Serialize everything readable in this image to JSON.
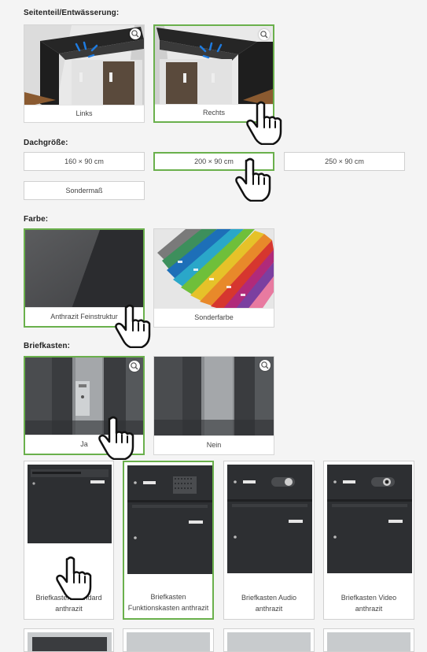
{
  "sections": {
    "seitenteil": {
      "title": "Seitenteil/Entwässerung:",
      "options": [
        "Links",
        "Rechts"
      ]
    },
    "dachgroesse": {
      "title": "Dachgröße:",
      "options": [
        "160 × 90 cm",
        "200 × 90 cm",
        "250 × 90 cm",
        "Sondermaß"
      ]
    },
    "farbe": {
      "title": "Farbe:",
      "options": [
        "Anthrazit Feinstruktur",
        "Sonderfarbe"
      ]
    },
    "briefkasten": {
      "title": "Briefkasten:",
      "options": [
        "Ja",
        "Nein"
      ]
    },
    "mailboxes": [
      {
        "label": "Briefkasten Standard anthrazit"
      },
      {
        "label": "Briefkasten Funktionskasten anthrazit"
      },
      {
        "label": "Briefkasten Audio anthrazit"
      },
      {
        "label": "Briefkasten Video anthrazit"
      }
    ]
  },
  "selected": {
    "seitenteil": "Rechts",
    "dachgroesse": "200 × 90 cm",
    "farbe": "Anthrazit Feinstruktur",
    "briefkasten": "Ja",
    "mailbox": "Briefkasten Funktionskasten anthrazit"
  },
  "colors": {
    "selected_border": "#6ab04c",
    "anthracite": "#2d2f32"
  },
  "icons": [
    "zoom-icon",
    "hand-pointer-icon"
  ]
}
